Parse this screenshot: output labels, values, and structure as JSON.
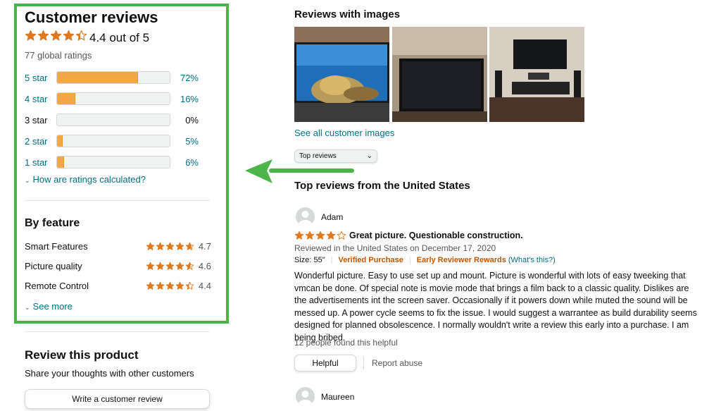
{
  "customer_reviews": {
    "title": "Customer reviews",
    "rating": 4.4,
    "average_text": "4.4 out of 5",
    "global_ratings": "77 global ratings",
    "histogram": [
      {
        "label": "5 star",
        "pct": "72%",
        "fraction": 0.72
      },
      {
        "label": "4 star",
        "pct": "16%",
        "fraction": 0.16
      },
      {
        "label": "3 star",
        "pct": "0%",
        "fraction": 0.0
      },
      {
        "label": "2 star",
        "pct": "5%",
        "fraction": 0.05
      },
      {
        "label": "1 star",
        "pct": "6%",
        "fraction": 0.06
      }
    ],
    "how_calculated": "How are ratings calculated?"
  },
  "by_feature": {
    "title": "By feature",
    "items": [
      {
        "name": "Smart Features",
        "value": "4.7",
        "rating": 4.7
      },
      {
        "name": "Picture quality",
        "value": "4.6",
        "rating": 4.6
      },
      {
        "name": "Remote Control",
        "value": "4.4",
        "rating": 4.4
      }
    ],
    "see_more": "See more"
  },
  "review_product": {
    "title": "Review this product",
    "subtitle": "Share your thoughts with other customers",
    "button": "Write a customer review"
  },
  "images_section": {
    "title": "Reviews with images",
    "see_all": "See all customer images"
  },
  "sort": {
    "selected": "Top reviews"
  },
  "top_reviews_title": "Top reviews from the United States",
  "reviews": [
    {
      "name": "Adam",
      "rating": 4,
      "headline": "Great picture. Questionable construction.",
      "date": "Reviewed in the United States on December 17, 2020",
      "size": "Size: 55\"",
      "verified": "Verified Purchase",
      "early_rewards": "Early Reviewer Rewards",
      "whats_this": "(What's this?)",
      "body": "Wonderful picture. Easy to use set up and mount. Picture is wonderful with lots of easy tweeking that vmcan be done. Of special note is movie mode that brings a film back to a classic quality. Dislikes are the advertisements int the screen saver. Occasionally if it powers down while muted the sound will be messed up. A power cycle seems to fix the issue. I would suggest a warrantee as build durability seems designed for planned obsolescence. I normally wouldn't write a review this early into a purchase. I am being bribed.",
      "helpful_count": "12 people found this helpful",
      "helpful_label": "Helpful",
      "report_label": "Report abuse"
    },
    {
      "name": "Maureen"
    }
  ],
  "colors": {
    "highlight": "#4cb548",
    "star": "#de7921",
    "bar_fill": "#f3a847",
    "link": "#007185"
  }
}
